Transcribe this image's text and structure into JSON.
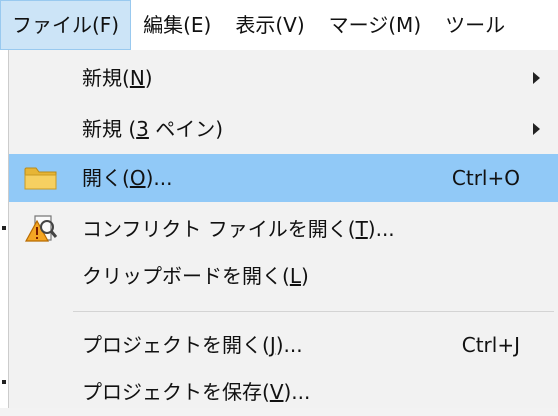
{
  "menubar": {
    "items": [
      {
        "label": "ファイル(F)",
        "active": true
      },
      {
        "label": "編集(E)",
        "active": false
      },
      {
        "label": "表示(V)",
        "active": false
      },
      {
        "label": "マージ(M)",
        "active": false
      },
      {
        "label": "ツール",
        "active": false
      }
    ]
  },
  "menu": {
    "new": {
      "prefix": "新規(",
      "mnemonic": "N",
      "suffix": ")"
    },
    "new3": {
      "prefix": "新規 (",
      "mnemonic": "3",
      "suffix": " ペイン)"
    },
    "open": {
      "prefix": "開く(",
      "mnemonic": "O",
      "suffix": ")...",
      "shortcut": "Ctrl+O",
      "icon": "folder-icon"
    },
    "open_conflict": {
      "prefix": "コンフリクト ファイルを開く(",
      "mnemonic": "T",
      "suffix": ")...",
      "icon": "conflict-file-icon"
    },
    "open_clipboard": {
      "prefix": "クリップボードを開く(",
      "mnemonic": "L",
      "suffix": ")"
    },
    "open_project": {
      "prefix": "プロジェクトを開く(",
      "mnemonic": "J",
      "suffix": ")...",
      "shortcut": "Ctrl+J"
    },
    "save_project": {
      "prefix": "プロジェクトを保存(",
      "mnemonic": "V",
      "suffix": ")..."
    }
  },
  "colors": {
    "highlight": "#91c9f7",
    "menubar_active": "#cce4f7",
    "folder": "#f2c84b"
  }
}
